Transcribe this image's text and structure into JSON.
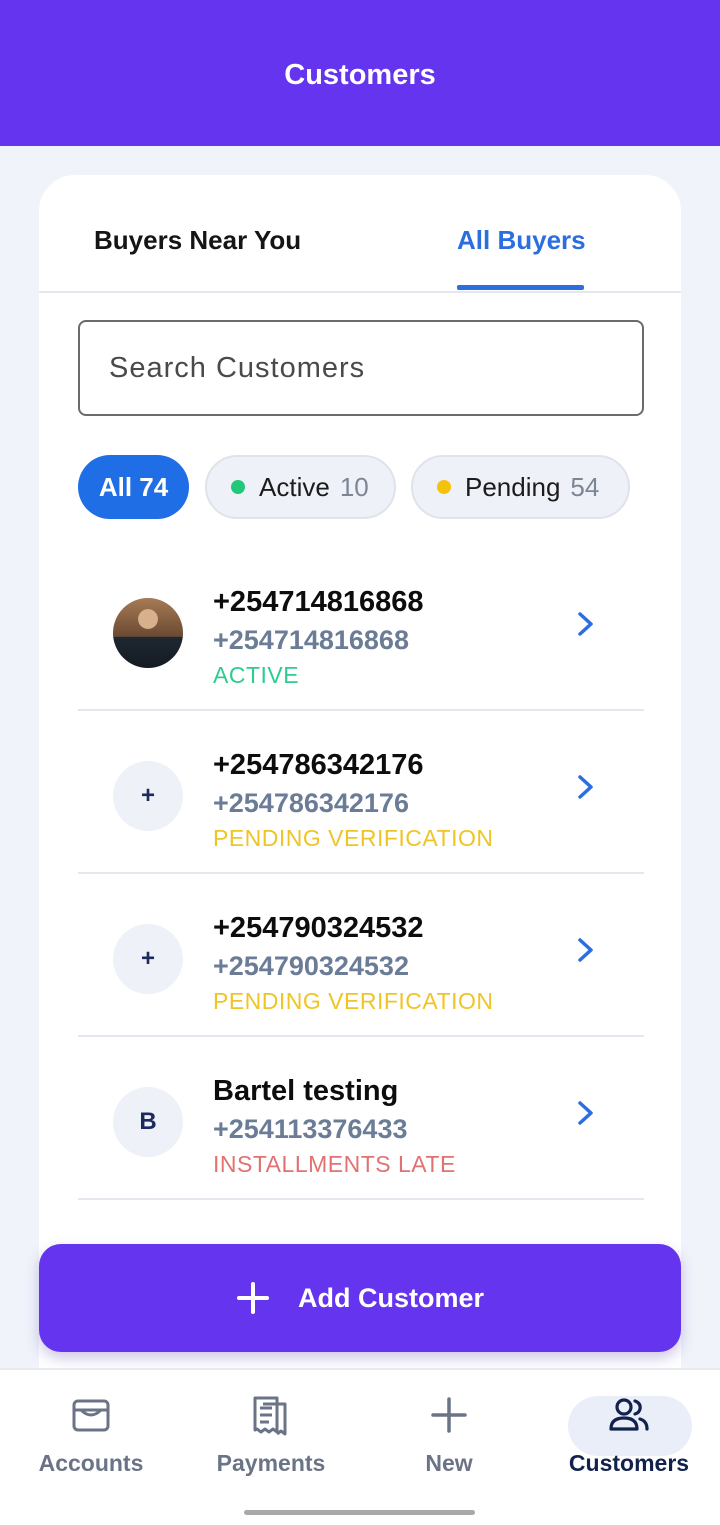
{
  "header": {
    "title": "Customers"
  },
  "tabs": [
    {
      "label": "Buyers Near You",
      "selected": false
    },
    {
      "label": "All Buyers",
      "selected": true
    }
  ],
  "search": {
    "placeholder": "Search Customers",
    "value": ""
  },
  "filters": {
    "all": {
      "label": "All",
      "count": "74",
      "text": "All 74"
    },
    "active": {
      "label": "Active",
      "count": "10",
      "dot_color": "#22c87a"
    },
    "pending": {
      "label": "Pending",
      "count": "54",
      "dot_color": "#f4c20d"
    }
  },
  "customers": [
    {
      "name": "+254714816868",
      "phone": "+254714816868",
      "status": "ACTIVE",
      "status_color": "#2ecc8f",
      "avatar": "photo"
    },
    {
      "name": "+254786342176",
      "phone": "+254786342176",
      "status": "PENDING VERIFICATION",
      "status_color": "#efc526",
      "avatar": "+"
    },
    {
      "name": "+254790324532",
      "phone": "+254790324532",
      "status": "PENDING VERIFICATION",
      "status_color": "#efc526",
      "avatar": "+"
    },
    {
      "name": "Bartel testing",
      "phone": "+254113376433",
      "status": "INSTALLMENTS LATE",
      "status_color": "#e27272",
      "avatar": "B"
    }
  ],
  "add_button": {
    "label": "Add Customer",
    "icon": "plus-icon"
  },
  "bottom_nav": [
    {
      "label": "Accounts",
      "icon": "wallet-icon"
    },
    {
      "label": "Payments",
      "icon": "receipt-icon"
    },
    {
      "label": "New",
      "icon": "plus-icon"
    },
    {
      "label": "Customers",
      "icon": "users-icon",
      "selected": true
    }
  ],
  "colors": {
    "brand": "#6434ee",
    "accent_blue": "#2a6ee0",
    "chip_blue": "#1f6ee6"
  }
}
